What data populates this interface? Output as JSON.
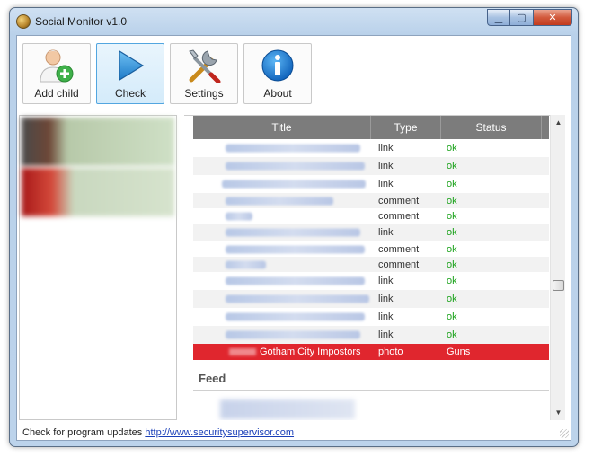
{
  "window": {
    "title": "Social Monitor v1.0",
    "min_glyph": "▁",
    "max_glyph": "▢",
    "close_glyph": "✕"
  },
  "toolbar": {
    "buttons": [
      {
        "label": "Add child",
        "icon": "add-user-icon"
      },
      {
        "label": "Check",
        "icon": "play-icon"
      },
      {
        "label": "Settings",
        "icon": "tools-icon"
      },
      {
        "label": "About",
        "icon": "info-icon"
      }
    ]
  },
  "table": {
    "headers": {
      "title": "Title",
      "type": "Type",
      "status": "Status"
    },
    "rows": [
      {
        "type": "link",
        "status": "ok"
      },
      {
        "type": "link",
        "status": "ok"
      },
      {
        "type": "link",
        "status": "ok"
      },
      {
        "type": "comment",
        "status": "ok"
      },
      {
        "type": "comment",
        "status": "ok"
      },
      {
        "type": "link",
        "status": "ok"
      },
      {
        "type": "comment",
        "status": "ok"
      },
      {
        "type": "comment",
        "status": "ok"
      },
      {
        "type": "link",
        "status": "ok"
      },
      {
        "type": "link",
        "status": "ok"
      },
      {
        "type": "link",
        "status": "ok"
      },
      {
        "type": "link",
        "status": "ok"
      }
    ],
    "flagged_row": {
      "title": "Gotham City Impostors",
      "type": "photo",
      "status": "Guns"
    }
  },
  "feed": {
    "title": "Feed"
  },
  "footer": {
    "text": "Check for program updates ",
    "link": "http://www.securitysupervisor.com"
  },
  "colors": {
    "ok": "#1aa21a",
    "flag_bg": "#e0262e",
    "header_bg": "#7c7c7c",
    "active_button": "#52a6e0"
  }
}
